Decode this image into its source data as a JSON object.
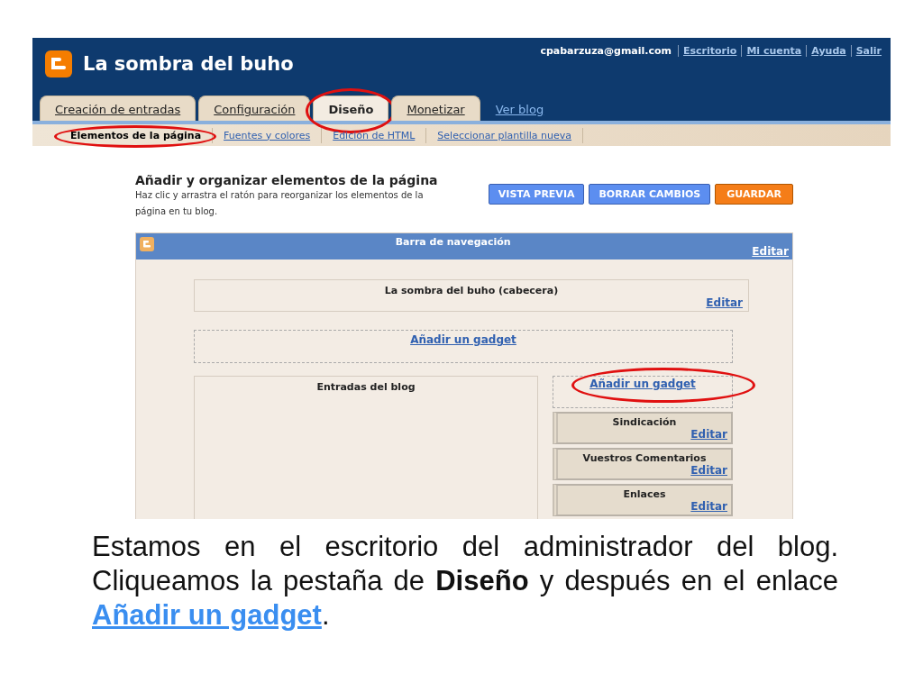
{
  "blog_header": {
    "title": "La sombra del buho",
    "user_email": "cpabarzuza@gmail.com",
    "links": [
      "Escritorio",
      "Mi cuenta",
      "Ayuda",
      "Salir"
    ]
  },
  "tabs": [
    {
      "label": "Creación de entradas",
      "selected": false,
      "circled": false
    },
    {
      "label": "Configuración",
      "selected": false,
      "circled": false
    },
    {
      "label": "Diseño",
      "selected": true,
      "circled": true
    },
    {
      "label": "Monetizar",
      "selected": false,
      "circled": false
    }
  ],
  "view_blog_link": "Ver blog",
  "subtabs": [
    {
      "label": "Elementos de la página",
      "selected": true,
      "circled": true
    },
    {
      "label": "Fuentes y colores",
      "selected": false,
      "circled": false
    },
    {
      "label": "Edición de HTML",
      "selected": false,
      "circled": false
    },
    {
      "label": "Seleccionar plantilla nueva",
      "selected": false,
      "circled": false
    }
  ],
  "page_title": "Añadir y organizar elementos de la página",
  "description": "Haz clic y arrastra el ratón para reorganizar los elementos de la página en tu blog.",
  "buttons": [
    {
      "label": "VISTA PREVIA",
      "kind": "secondary"
    },
    {
      "label": "BORRAR CAMBIOS",
      "kind": "secondary"
    },
    {
      "label": "GUARDAR",
      "kind": "primary"
    }
  ],
  "layout": {
    "navbar": {
      "title": "Barra de navegación",
      "edit": "Editar"
    },
    "header_widget": {
      "title": "La sombra del buho (cabecera)",
      "edit": "Editar"
    },
    "add_gadget_top": {
      "label": "Añadir un gadget"
    },
    "main": {
      "title": "Entradas del blog"
    },
    "sidebar": {
      "add_gadget": {
        "label": "Añadir un gadget",
        "circled": true
      },
      "widgets": [
        {
          "title": "Sindicación",
          "edit": "Editar"
        },
        {
          "title": "Vuestros Comentarios",
          "edit": "Editar"
        },
        {
          "title": "Enlaces",
          "edit": "Editar"
        }
      ]
    }
  },
  "caption": {
    "text": "Estamos en el escritorio del administrador del blog. Cliqueamos la pestaña de **Diseño** y después en el enlace ",
    "link": "Añadir un gadget",
    "end": "."
  }
}
